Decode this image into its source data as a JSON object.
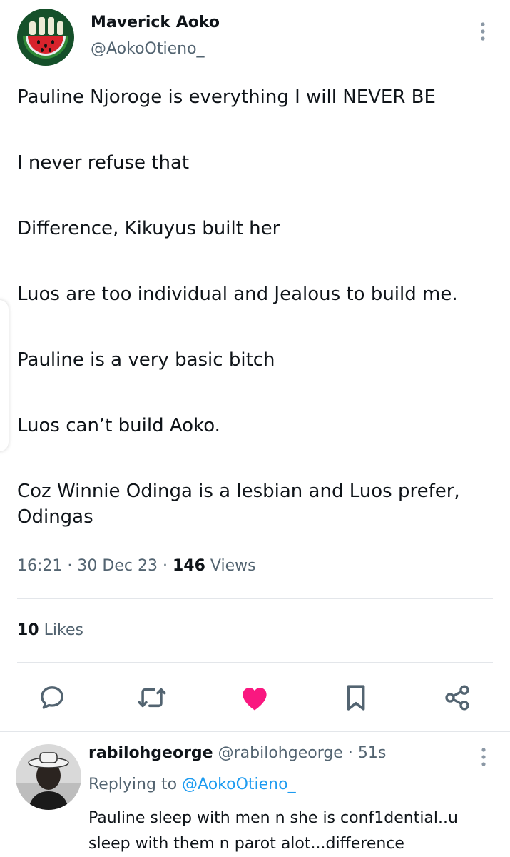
{
  "tweet": {
    "author_name": "Maverick Aoko",
    "author_handle": "@AokoOtieno_",
    "paragraphs": [
      "Pauline Njoroge is everything I will NEVER BE",
      "I never refuse that",
      "Difference, Kikuyus built her",
      "Luos are too individual and Jealous to build me.",
      "Pauline is a very basic bitch",
      "Luos can’t build Aoko.",
      "Coz Winnie Odinga is a lesbian and Luos prefer, Odingas"
    ],
    "time": "16:21",
    "date": "30 Dec 23",
    "views_count": "146",
    "views_label": "Views",
    "likes_count": "10",
    "likes_label": "Likes"
  },
  "actions": {
    "icons": [
      "comment-icon",
      "retweet-icon",
      "like-icon",
      "bookmark-icon",
      "share-icon"
    ],
    "liked": true,
    "like_color": "#f91880",
    "icon_color": "#536471"
  },
  "reply": {
    "name": "rabilohgeorge",
    "handle": "@rabilohgeorge",
    "time": "51s",
    "replying_label": "Replying to",
    "replying_to": "@AokoOtieno_",
    "text": "Pauline sleep with men n she is conf1dential..u sleep with them n parot alot...difference"
  },
  "colors": {
    "text": "#0f1419",
    "secondary": "#536471",
    "link": "#1d9bf0",
    "divider": "#e3e6ea"
  }
}
